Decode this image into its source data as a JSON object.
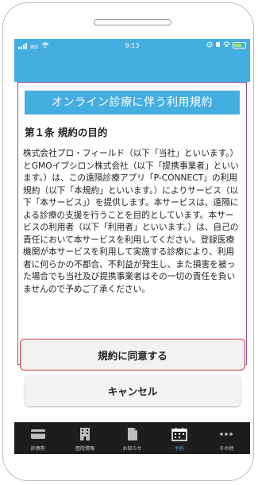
{
  "status_bar": {
    "carrier": "au",
    "time": "9:13"
  },
  "terms": {
    "title": "オンライン診療に伴う利用規約",
    "article_heading": "第１条 規約の目的",
    "article_body": "株式会社プロ・フィールド（以下「当社」といいます。）とGMOイプシロン株式会社（以下「提携事業者」といいます。）は、この遠隔診療アプリ「P-CONNECT」の利用規約（以下「本規約」といいます。）によりサービス（以下「本サービス」）を提供します。本サービスは、遠隔による診療の支援を行うことを目的としています。本サービスの利用者（以下「利用者」といいます。）は、自己の責任において本サービスを利用してください。登録医療機関が本サービスを利用して実施する診療により、利用者に何らかの不都合、不利益が発生し、また損害を被った場合でも当社及び提携事業者はその一切の責任を負いませんので予めご了承ください。"
  },
  "buttons": {
    "agree": "規約に同意する",
    "cancel": "キャンセル"
  },
  "tabs": [
    {
      "label": "診察券",
      "icon": "card-icon",
      "active": false
    },
    {
      "label": "医院情報",
      "icon": "building-icon",
      "active": false
    },
    {
      "label": "お知らせ",
      "icon": "document-icon",
      "active": false
    },
    {
      "label": "予約",
      "icon": "calendar-icon",
      "active": true
    },
    {
      "label": "その他",
      "icon": "more-icon",
      "active": false
    }
  ],
  "colors": {
    "accent": "#45aee1",
    "frame": "#8c4fa6",
    "agree_border": "#d43b3b",
    "tab_bar": "#1d1d1d"
  }
}
